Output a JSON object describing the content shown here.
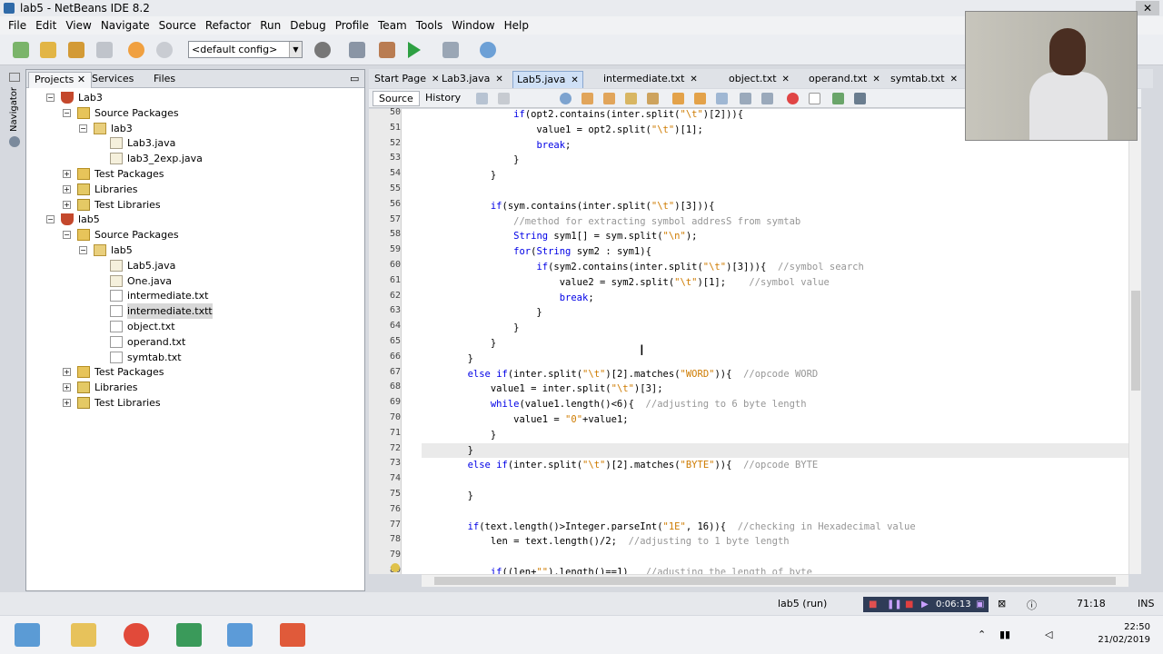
{
  "window": {
    "title": "lab5 - NetBeans IDE 8.2",
    "close_label": "✕"
  },
  "menu": [
    "File",
    "Edit",
    "View",
    "Navigate",
    "Source",
    "Refactor",
    "Run",
    "Debug",
    "Profile",
    "Team",
    "Tools",
    "Window",
    "Help"
  ],
  "toolbar": {
    "config_value": "<default config>"
  },
  "left_tabs": [
    "Projects",
    "Services",
    "Files"
  ],
  "navigator_label": "Navigator",
  "tree": [
    {
      "label": "Lab3",
      "icon": "project-cup-icon",
      "level": 0,
      "expanded": true
    },
    {
      "label": "Source Packages",
      "icon": "folder-icon",
      "level": 1,
      "expanded": true
    },
    {
      "label": "lab3",
      "icon": "package-icon",
      "level": 2,
      "expanded": true
    },
    {
      "label": "Lab3.java",
      "icon": "java-file-icon",
      "level": 3
    },
    {
      "label": "lab3_2exp.java",
      "icon": "java-file-icon",
      "level": 3
    },
    {
      "label": "Test Packages",
      "icon": "folder-icon",
      "level": 1,
      "expanded": false
    },
    {
      "label": "Libraries",
      "icon": "library-icon",
      "level": 1,
      "expanded": false
    },
    {
      "label": "Test Libraries",
      "icon": "library-icon",
      "level": 1,
      "expanded": false
    },
    {
      "label": "lab5",
      "icon": "project-cup-icon",
      "level": 0,
      "expanded": true
    },
    {
      "label": "Source Packages",
      "icon": "folder-icon",
      "level": 1,
      "expanded": true
    },
    {
      "label": "lab5",
      "icon": "package-icon",
      "level": 2,
      "expanded": true
    },
    {
      "label": "Lab5.java",
      "icon": "java-file-icon",
      "level": 3
    },
    {
      "label": "One.java",
      "icon": "java-file-icon",
      "level": 3
    },
    {
      "label": "intermediate.txt",
      "icon": "text-file-icon",
      "level": 3
    },
    {
      "label": "intermediate.txtt",
      "icon": "text-file-icon",
      "level": 3,
      "selected": true
    },
    {
      "label": "object.txt",
      "icon": "text-file-icon",
      "level": 3
    },
    {
      "label": "operand.txt",
      "icon": "text-file-icon",
      "level": 3
    },
    {
      "label": "symtab.txt",
      "icon": "text-file-icon",
      "level": 3
    },
    {
      "label": "Test Packages",
      "icon": "folder-icon",
      "level": 1,
      "expanded": false
    },
    {
      "label": "Libraries",
      "icon": "library-icon",
      "level": 1,
      "expanded": false
    },
    {
      "label": "Test Libraries",
      "icon": "library-icon",
      "level": 1,
      "expanded": false
    }
  ],
  "editor_tabs": [
    "Start Page",
    "Lab3.java",
    "Lab5.java",
    "intermediate.txt",
    "object.txt",
    "operand.txt",
    "symtab.txt"
  ],
  "active_editor_tab": "Lab5.java",
  "editor_modes": [
    "Source",
    "History"
  ],
  "code_lines": [
    {
      "n": "50",
      "t": "                if(opt2.contains(inter.split(\"\\t\")[2])){"
    },
    {
      "n": "51",
      "t": "                    value1 = opt2.split(\"\\t\")[1];"
    },
    {
      "n": "52",
      "t": "                    break;"
    },
    {
      "n": "53",
      "t": "                }"
    },
    {
      "n": "54",
      "t": "            }"
    },
    {
      "n": "55",
      "t": ""
    },
    {
      "n": "56",
      "t": "            if(sym.contains(inter.split(\"\\t\")[3])){"
    },
    {
      "n": "57",
      "t": "                //method for extracting symbol addresS from symtab"
    },
    {
      "n": "58",
      "t": "                String sym1[] = sym.split(\"\\n\");"
    },
    {
      "n": "59",
      "t": "                for(String sym2 : sym1){"
    },
    {
      "n": "60",
      "t": "                    if(sym2.contains(inter.split(\"\\t\")[3])){  //symbol search"
    },
    {
      "n": "61",
      "t": "                        value2 = sym2.split(\"\\t\")[1];    //symbol value"
    },
    {
      "n": "62",
      "t": "                        break;"
    },
    {
      "n": "63",
      "t": "                    }"
    },
    {
      "n": "64",
      "t": "                }"
    },
    {
      "n": "65",
      "t": "            }"
    },
    {
      "n": "66",
      "t": "        }"
    },
    {
      "n": "67",
      "t": "        else if(inter.split(\"\\t\")[2].matches(\"WORD\")){  //opcode WORD"
    },
    {
      "n": "68",
      "t": "            value1 = inter.split(\"\\t\")[3];"
    },
    {
      "n": "69",
      "t": "            while(value1.length()<6){  //adjusting to 6 byte length"
    },
    {
      "n": "70",
      "t": "                value1 = \"0\"+value1;"
    },
    {
      "n": "71",
      "t": "            }"
    },
    {
      "n": "72",
      "t": "        }"
    },
    {
      "n": "73",
      "t": "        else if(inter.split(\"\\t\")[2].matches(\"BYTE\")){  //opcode BYTE"
    },
    {
      "n": "74",
      "t": ""
    },
    {
      "n": "75",
      "t": "        }"
    },
    {
      "n": "76",
      "t": ""
    },
    {
      "n": "77",
      "t": "        if(text.length()>Integer.parseInt(\"1E\", 16)){  //checking in Hexadecimal value"
    },
    {
      "n": "78",
      "t": "            len = text.length()/2;  //adjusting to 1 byte length"
    },
    {
      "n": "79",
      "t": ""
    },
    {
      "n": "80",
      "t": "            if((len+\"\").length()==1)   //adusting the length of byte"
    }
  ],
  "status": {
    "project": "lab5 (run)",
    "timer": "0:06:13",
    "position": "71:18",
    "mode": "INS"
  },
  "clock": {
    "time": "22:50",
    "date": "21/02/2019"
  }
}
